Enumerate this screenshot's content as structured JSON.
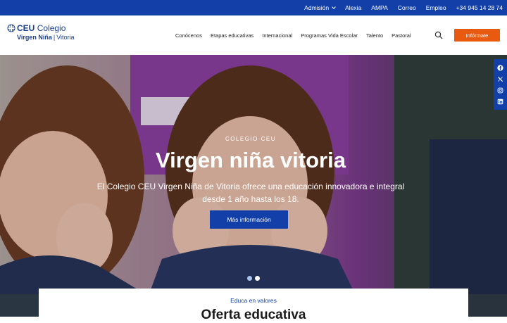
{
  "topbar": {
    "links": [
      {
        "label": "Admisión",
        "has_dropdown": true
      },
      {
        "label": "Alexia"
      },
      {
        "label": "AMPA"
      },
      {
        "label": "Correo"
      },
      {
        "label": "Empleo"
      },
      {
        "label": "+34 945 14 28 74"
      }
    ],
    "color": "#1240a8"
  },
  "header": {
    "logo": {
      "brand": "CEU",
      "name": "Colegio",
      "school": "Virgen Niña",
      "city": "Vitoria"
    },
    "nav": [
      "Conócenos",
      "Etapas educativas",
      "Internacional",
      "Programas Vida Escolar",
      "Talento",
      "Pastoral"
    ],
    "search_icon": "search-icon",
    "cta_label": "Infórmate",
    "cta_color": "#e85a10"
  },
  "hero": {
    "kicker": "COLEGIO CEU",
    "title": "Virgen niña vitoria",
    "subtitle_line1": "El Colegio CEU Virgen Niña de Vitoria ofrece una educación innovadora e integral",
    "subtitle_line2": "desde 1 año hasta los 18.",
    "button_label": "Más información",
    "slides_total": 2,
    "active_slide": 1
  },
  "social": [
    "facebook-icon",
    "x-icon",
    "instagram-icon",
    "linkedin-icon"
  ],
  "section": {
    "kicker": "Educa en valores",
    "title": "Oferta educativa"
  }
}
